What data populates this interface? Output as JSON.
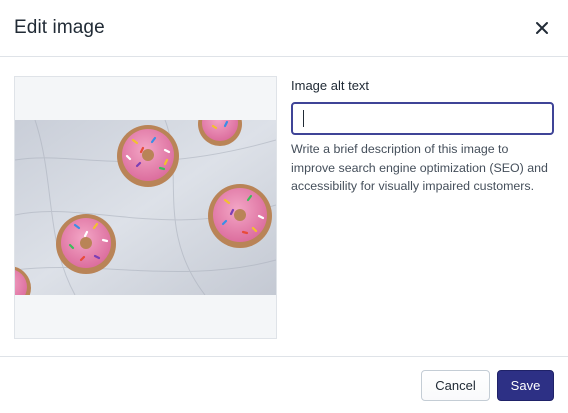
{
  "modal": {
    "title": "Edit image",
    "close_icon": "close-icon"
  },
  "image": {
    "description_icon": "donuts-photo"
  },
  "form": {
    "label": "Image alt text",
    "value": "",
    "help_text": "Write a brief description of this image to improve search engine optimization (SEO) and accessibility for visually impaired customers."
  },
  "footer": {
    "cancel_label": "Cancel",
    "save_label": "Save"
  },
  "colors": {
    "primary": "#2d3085",
    "focus_border": "#3f4497",
    "divider": "#dfe3e8"
  }
}
